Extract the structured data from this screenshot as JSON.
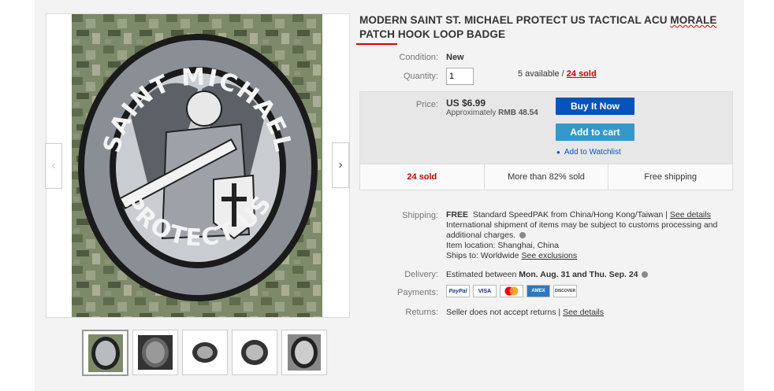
{
  "listing": {
    "title_part1": "MODERN SAINT ST. MICHAEL PROTECT US TACTICAL ACU ",
    "title_part2": "MORALE",
    "title_part3": " PATCH HOOK LOOP BADGE",
    "patch_text_top": "SAINT MICHAEL",
    "patch_text_bottom": "PROTECT US"
  },
  "details": {
    "condition_label": "Condition:",
    "condition_value": "New",
    "quantity_label": "Quantity:",
    "quantity_value": "1",
    "available_text": "5 available / ",
    "sold_link": "24 sold",
    "price_label": "Price:",
    "price_value": "US $6.99",
    "approx_prefix": "Approximately ",
    "approx_value": "RMB 48.54"
  },
  "actions": {
    "buy_now": "Buy It Now",
    "add_to_cart": "Add to cart",
    "watchlist": "Add to Watchlist"
  },
  "stats": [
    "24 sold",
    "More than 82% sold",
    "Free shipping"
  ],
  "shipping": {
    "label": "Shipping:",
    "free": "FREE",
    "method": "Standard SpeedPAK from China/Hong Kong/Taiwan | ",
    "see_details": "See details",
    "note": "International shipment of items may be subject to customs processing and additional charges.",
    "location": "Item location:  Shanghai, China",
    "ships_to_prefix": "Ships to:  Worldwide  ",
    "see_exclusions": "See exclusions"
  },
  "delivery": {
    "label": "Delivery:",
    "prefix": "Estimated between ",
    "dates": "Mon. Aug. 31 and Thu. Sep. 24"
  },
  "payments": {
    "label": "Payments:",
    "cards": [
      "PayPal",
      "VISA",
      "MasterCard",
      "AmEx",
      "DISCOVER"
    ]
  },
  "returns": {
    "label": "Returns:",
    "text": "Seller does not accept returns | ",
    "see_details": "See details"
  },
  "colors": {
    "buy_button": "#0654ba",
    "cart_button": "#3498ca",
    "sold_red": "#c00000"
  }
}
